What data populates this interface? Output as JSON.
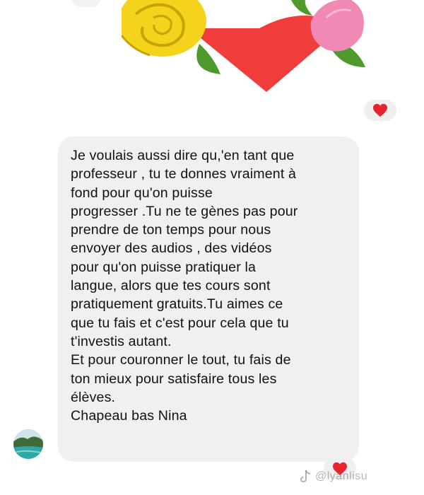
{
  "message": {
    "lines": [
      "Je voulais aussi dire qu,'en tant que",
      "professeur , tu te donnes vraiment à",
      "fond pour qu'on puisse",
      "progresser .Tu ne te gènes pas pour",
      "prendre de ton temps pour nous",
      "envoyer des audios , des vidéos",
      "pour qu'on puisse pratiquer la",
      "langue, alors que tes cours sont",
      "pratiquement gratuits.Tu aimes ce",
      "que tu fais et c'est pour cela que tu",
      "t'investis autant.",
      "Et pour couronner le tout, tu fais  de",
      "ton mieux pour satisfaire tous les",
      "élèves.",
      "Chapeau bas Nina"
    ]
  },
  "reactions": [
    {
      "icon": "heart-icon",
      "color": "#e8232e"
    },
    {
      "icon": "heart-icon",
      "color": "#e8232e"
    }
  ],
  "sticker": {
    "icon": "heart-with-roses-sticker",
    "colors": {
      "heart": "#f13c3c",
      "yellow_rose": "#f5d21b",
      "pink_rose": "#f08ab4",
      "leaf": "#4f9a2d"
    }
  },
  "watermark": {
    "text": "@lyanlisu"
  },
  "colors": {
    "bubble_bg": "#f0f0f0",
    "text": "#111111",
    "reaction_bg": "#efefef"
  }
}
